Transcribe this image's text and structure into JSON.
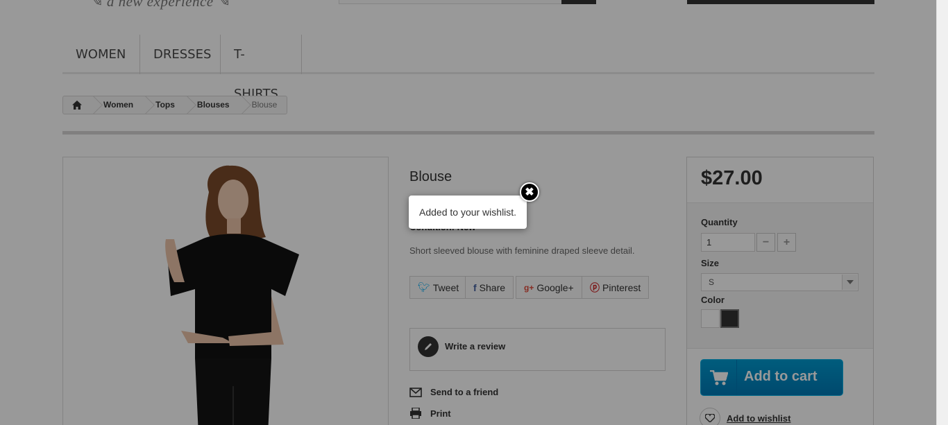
{
  "header": {
    "logo_tagline": "a new experience"
  },
  "menu": {
    "items": [
      "WOMEN",
      "DRESSES",
      "T-SHIRTS"
    ]
  },
  "breadcrumb": {
    "items": [
      "Women",
      "Tops",
      "Blouses"
    ],
    "current": "Blouse"
  },
  "product": {
    "name": "Blouse",
    "condition": "Condition: New",
    "description": "Short sleeved blouse with feminine draped sleeve detail.",
    "social": {
      "tweet": "Tweet",
      "share": "Share",
      "google": "Google+",
      "pinterest": "Pinterest"
    },
    "write_review": "Write a review",
    "send_to_friend": "Send to a friend",
    "print": "Print"
  },
  "buy_box": {
    "price": "$27.00",
    "quantity_label": "Quantity",
    "quantity_value": "1",
    "size_label": "Size",
    "size_value": "S",
    "color_label": "Color",
    "colors": [
      "#ffffff",
      "#333333"
    ],
    "add_to_cart": "Add to cart",
    "add_to_wishlist": "Add to wishlist"
  },
  "popup": {
    "message": "Added to your wishlist."
  },
  "accent_colors": {
    "cart_button": "#009ad0",
    "overlay": "rgba(0,0,0,0.4)"
  }
}
